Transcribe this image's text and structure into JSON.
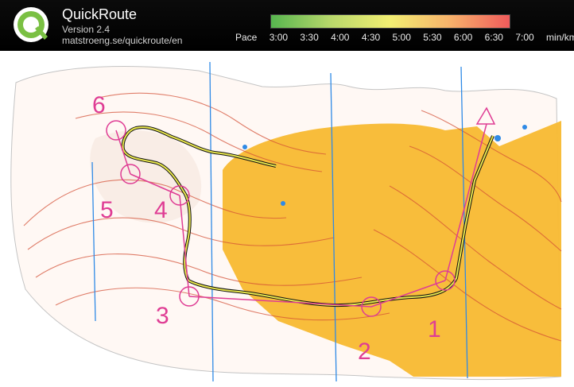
{
  "app": {
    "name": "QuickRoute",
    "version": "Version 2.4",
    "url": "matstroeng.se/quickroute/en",
    "logo_letter": "Q"
  },
  "pace": {
    "label": "Pace",
    "ticks": [
      "3:00",
      "3:30",
      "4:00",
      "4:30",
      "5:00",
      "5:30",
      "6:00",
      "6:30",
      "7:00"
    ],
    "unit": "min/km",
    "gradient_colors": [
      "#57b54f",
      "#b8d86b",
      "#f2ee72",
      "#f7b26b",
      "#ef5b5b"
    ]
  },
  "map": {
    "control_labels": [
      "1",
      "2",
      "3",
      "4",
      "5",
      "6"
    ],
    "colors": {
      "forest": "#f8ba33",
      "contour": "#d44f35",
      "route": "#e7e54d",
      "control": "#df3d94",
      "meridian": "#2f8ae6"
    }
  }
}
